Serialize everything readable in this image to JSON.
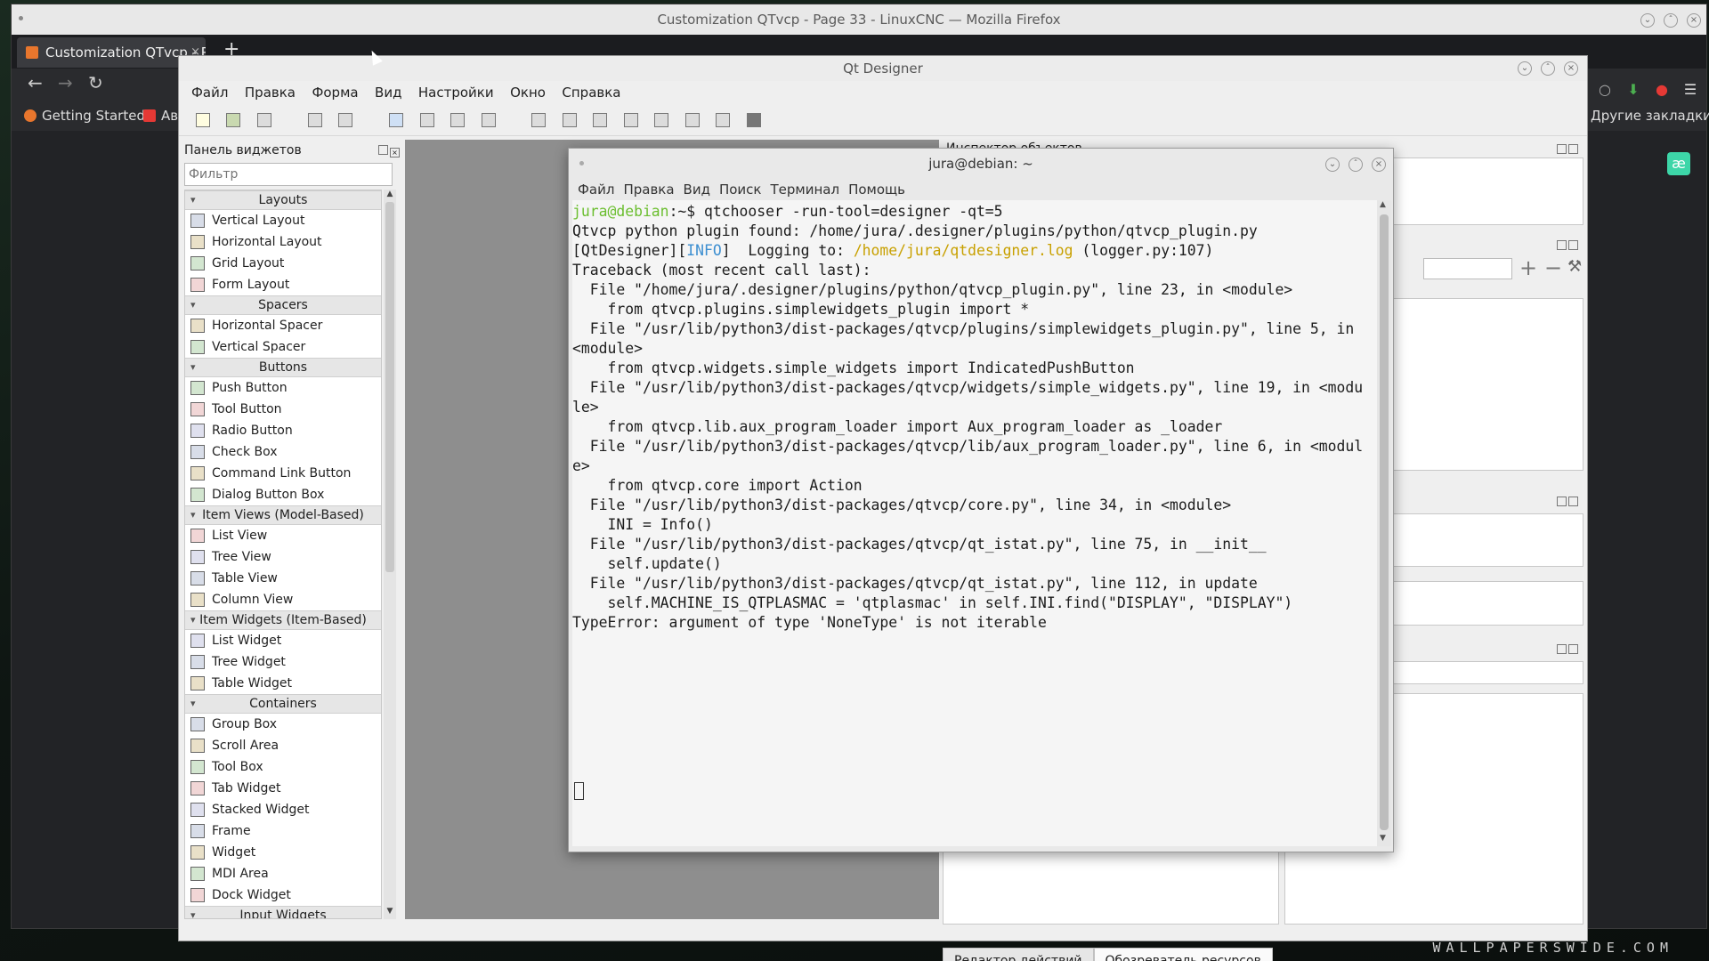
{
  "firefox": {
    "window_title": "Customization QTvcp - Page 33 - LinuxCNC — Mozilla Firefox",
    "tab_label": "Customization QTvcp - P",
    "tab_close": "×",
    "new_tab": "+",
    "bookmarks": [
      "Getting Started",
      "Ав"
    ],
    "other_bookmarks": "Другие закладки"
  },
  "designer": {
    "window_title": "Qt Designer",
    "menu": [
      "Файл",
      "Правка",
      "Форма",
      "Вид",
      "Настройки",
      "Окно",
      "Справка"
    ],
    "widget_box": {
      "title": "Панель виджетов",
      "filter_placeholder": "Фильтр",
      "categories": [
        {
          "label": "Layouts",
          "items": [
            "Vertical Layout",
            "Horizontal Layout",
            "Grid Layout",
            "Form Layout"
          ]
        },
        {
          "label": "Spacers",
          "items": [
            "Horizontal Spacer",
            "Vertical Spacer"
          ]
        },
        {
          "label": "Buttons",
          "items": [
            "Push Button",
            "Tool Button",
            "Radio Button",
            "Check Box",
            "Command Link Button",
            "Dialog Button Box"
          ]
        },
        {
          "label": "Item Views (Model-Based)",
          "items": [
            "List View",
            "Tree View",
            "Table View",
            "Column View"
          ]
        },
        {
          "label": "Item Widgets (Item-Based)",
          "items": [
            "List Widget",
            "Tree Widget",
            "Table Widget"
          ]
        },
        {
          "label": "Containers",
          "items": [
            "Group Box",
            "Scroll Area",
            "Tool Box",
            "Tab Widget",
            "Stacked Widget",
            "Frame",
            "Widget",
            "MDI Area",
            "Dock Widget"
          ]
        },
        {
          "label": "Input Widgets",
          "items": []
        }
      ]
    },
    "inspector_title": "Инспектор объектов",
    "bottom_tabs": [
      "Редактор действий",
      "Обозреватель ресурсов"
    ]
  },
  "terminal": {
    "title": "jura@debian: ~",
    "menu": [
      "Файл",
      "Правка",
      "Вид",
      "Поиск",
      "Терминал",
      "Помощь"
    ],
    "prompt_user": "jura@debian",
    "prompt_rest": ":~$ qtchooser -run-tool=designer -qt=5",
    "log_prefix": "[QtDesigner][",
    "log_level": "INFO",
    "log_mid": "]  Logging to: ",
    "log_path": "/home/jura/qtdesigner.log",
    "log_suffix": " (logger.py:107)",
    "lines": [
      "Qtvcp python plugin found: /home/jura/.designer/plugins/python/qtvcp_plugin.py",
      "Traceback (most recent call last):",
      "  File \"/home/jura/.designer/plugins/python/qtvcp_plugin.py\", line 23, in <module>",
      "    from qtvcp.plugins.simplewidgets_plugin import *",
      "  File \"/usr/lib/python3/dist-packages/qtvcp/plugins/simplewidgets_plugin.py\", line 5, in",
      "<module>",
      "    from qtvcp.widgets.simple_widgets import IndicatedPushButton",
      "  File \"/usr/lib/python3/dist-packages/qtvcp/widgets/simple_widgets.py\", line 19, in <modu",
      "le>",
      "    from qtvcp.lib.aux_program_loader import Aux_program_loader as _loader",
      "  File \"/usr/lib/python3/dist-packages/qtvcp/lib/aux_program_loader.py\", line 6, in <modul",
      "e>",
      "    from qtvcp.core import Action",
      "  File \"/usr/lib/python3/dist-packages/qtvcp/core.py\", line 34, in <module>",
      "    INI = Info()",
      "  File \"/usr/lib/python3/dist-packages/qtvcp/qt_istat.py\", line 75, in __init__",
      "    self.update()",
      "  File \"/usr/lib/python3/dist-packages/qtvcp/qt_istat.py\", line 112, in update",
      "    self.MACHINE_IS_QTPLASMAC = 'qtplasmac' in self.INI.find(\"DISPLAY\", \"DISPLAY\")",
      "TypeError: argument of type 'NoneType' is not iterable"
    ]
  },
  "wallpaper_mark": "WALLPAPERSWIDE.COM",
  "colors": {
    "prompt_user": "#6bbe2f",
    "info": "#3d8fd1",
    "log_path": "#c8a000"
  }
}
